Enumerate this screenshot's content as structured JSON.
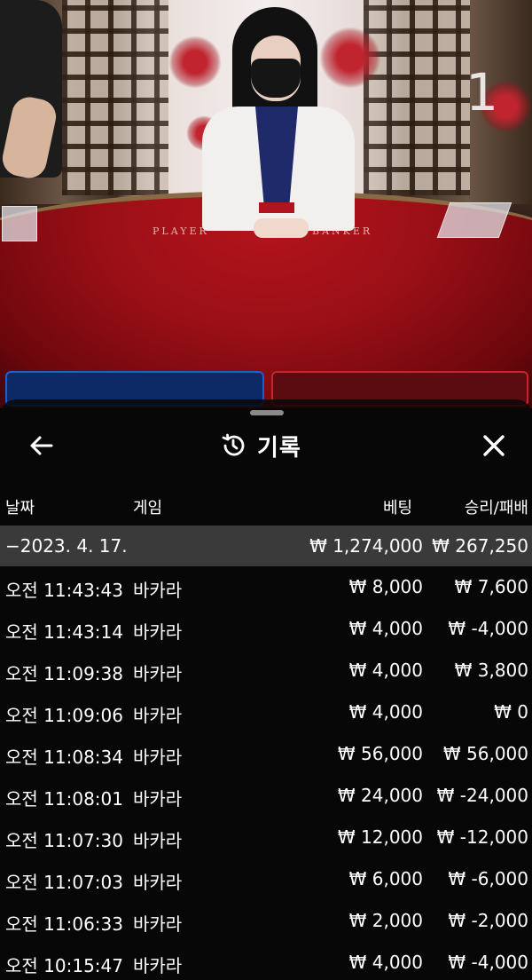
{
  "video": {
    "round_number": "1",
    "felt_player": "PLAYER",
    "felt_banker": "BANKER"
  },
  "sheet": {
    "title": "기록",
    "icons": {
      "back": "arrow-left-icon",
      "history": "history-clock-icon",
      "close": "close-icon"
    },
    "columns": {
      "date": "날짜",
      "game": "게임",
      "bet": "베팅",
      "result": "승리/패배"
    },
    "summary": {
      "date": "−2023. 4. 17.",
      "bet": "₩ 1,274,000",
      "result": "₩ 267,250"
    },
    "rows": [
      {
        "time": "오전 11:43:43",
        "game": "바카라",
        "bet": "₩ 8,000",
        "result": "₩ 7,600"
      },
      {
        "time": "오전 11:43:14",
        "game": "바카라",
        "bet": "₩ 4,000",
        "result": "₩ -4,000"
      },
      {
        "time": "오전 11:09:38",
        "game": "바카라",
        "bet": "₩ 4,000",
        "result": "₩ 3,800"
      },
      {
        "time": "오전 11:09:06",
        "game": "바카라",
        "bet": "₩ 4,000",
        "result": "₩ 0"
      },
      {
        "time": "오전 11:08:34",
        "game": "바카라",
        "bet": "₩ 56,000",
        "result": "₩ 56,000"
      },
      {
        "time": "오전 11:08:01",
        "game": "바카라",
        "bet": "₩ 24,000",
        "result": "₩ -24,000"
      },
      {
        "time": "오전 11:07:30",
        "game": "바카라",
        "bet": "₩ 12,000",
        "result": "₩ -12,000"
      },
      {
        "time": "오전 11:07:03",
        "game": "바카라",
        "bet": "₩ 6,000",
        "result": "₩ -6,000"
      },
      {
        "time": "오전 11:06:33",
        "game": "바카라",
        "bet": "₩ 2,000",
        "result": "₩ -2,000"
      },
      {
        "time": "오전 10:15:47",
        "game": "바카라",
        "bet": "₩ 4,000",
        "result": "₩ -4,000"
      }
    ]
  },
  "colors": {
    "sheet_bg": "#0a0a0a",
    "summary_bg": "#3a3a3a",
    "text": "#ffffff",
    "player_blue": "#1a5fd0",
    "banker_red": "#c8242c"
  }
}
